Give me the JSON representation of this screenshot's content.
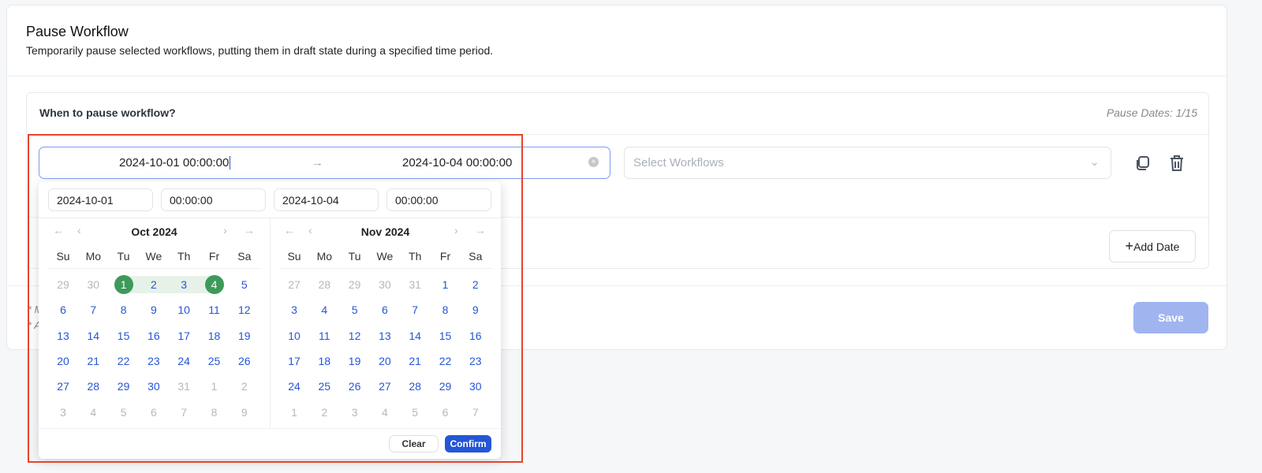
{
  "header": {
    "title": "Pause Workflow",
    "subtitle": "Temporarily pause selected workflows, putting them in draft state during a specified time period."
  },
  "section": {
    "question": "When to pause workflow?",
    "pause_dates": "Pause Dates: 1/15"
  },
  "range": {
    "start": "2024-10-01 00:00:00",
    "end": "2024-10-04 00:00:00"
  },
  "select": {
    "placeholder": "Select Workflows"
  },
  "buttons": {
    "add_date": "Add Date",
    "save": "Save",
    "clear": "Clear",
    "confirm": "Confirm"
  },
  "notes": [
    "* M",
    "* A"
  ],
  "picker": {
    "start_date": "2024-10-01",
    "start_time": "00:00:00",
    "end_date": "2024-10-04",
    "end_time": "00:00:00",
    "weekdays": [
      "Su",
      "Mo",
      "Tu",
      "We",
      "Th",
      "Fr",
      "Sa"
    ],
    "months": [
      {
        "label": "Oct 2024",
        "leading_muted": 2,
        "trailing_muted": 10,
        "selected": [
          "1",
          "4"
        ],
        "in_range": [
          "2",
          "3"
        ],
        "days": [
          "29",
          "30",
          "1",
          "2",
          "3",
          "4",
          "5",
          "6",
          "7",
          "8",
          "9",
          "10",
          "11",
          "12",
          "13",
          "14",
          "15",
          "16",
          "17",
          "18",
          "19",
          "20",
          "21",
          "22",
          "23",
          "24",
          "25",
          "26",
          "27",
          "28",
          "29",
          "30",
          "31",
          "1",
          "2",
          "3",
          "4",
          "5",
          "6",
          "7",
          "8",
          "9"
        ]
      },
      {
        "label": "Nov 2024",
        "leading_muted": 5,
        "trailing_muted": 7,
        "selected": [],
        "in_range": [],
        "days": [
          "27",
          "28",
          "29",
          "30",
          "31",
          "1",
          "2",
          "3",
          "4",
          "5",
          "6",
          "7",
          "8",
          "9",
          "10",
          "11",
          "12",
          "13",
          "14",
          "15",
          "16",
          "17",
          "18",
          "19",
          "20",
          "21",
          "22",
          "23",
          "24",
          "25",
          "26",
          "27",
          "28",
          "29",
          "30",
          "1",
          "2",
          "3",
          "4",
          "5",
          "6",
          "7"
        ]
      }
    ]
  },
  "colors": {
    "accent": "#2456d6",
    "selected": "#3d9a5a",
    "annotation": "#e8432c"
  }
}
